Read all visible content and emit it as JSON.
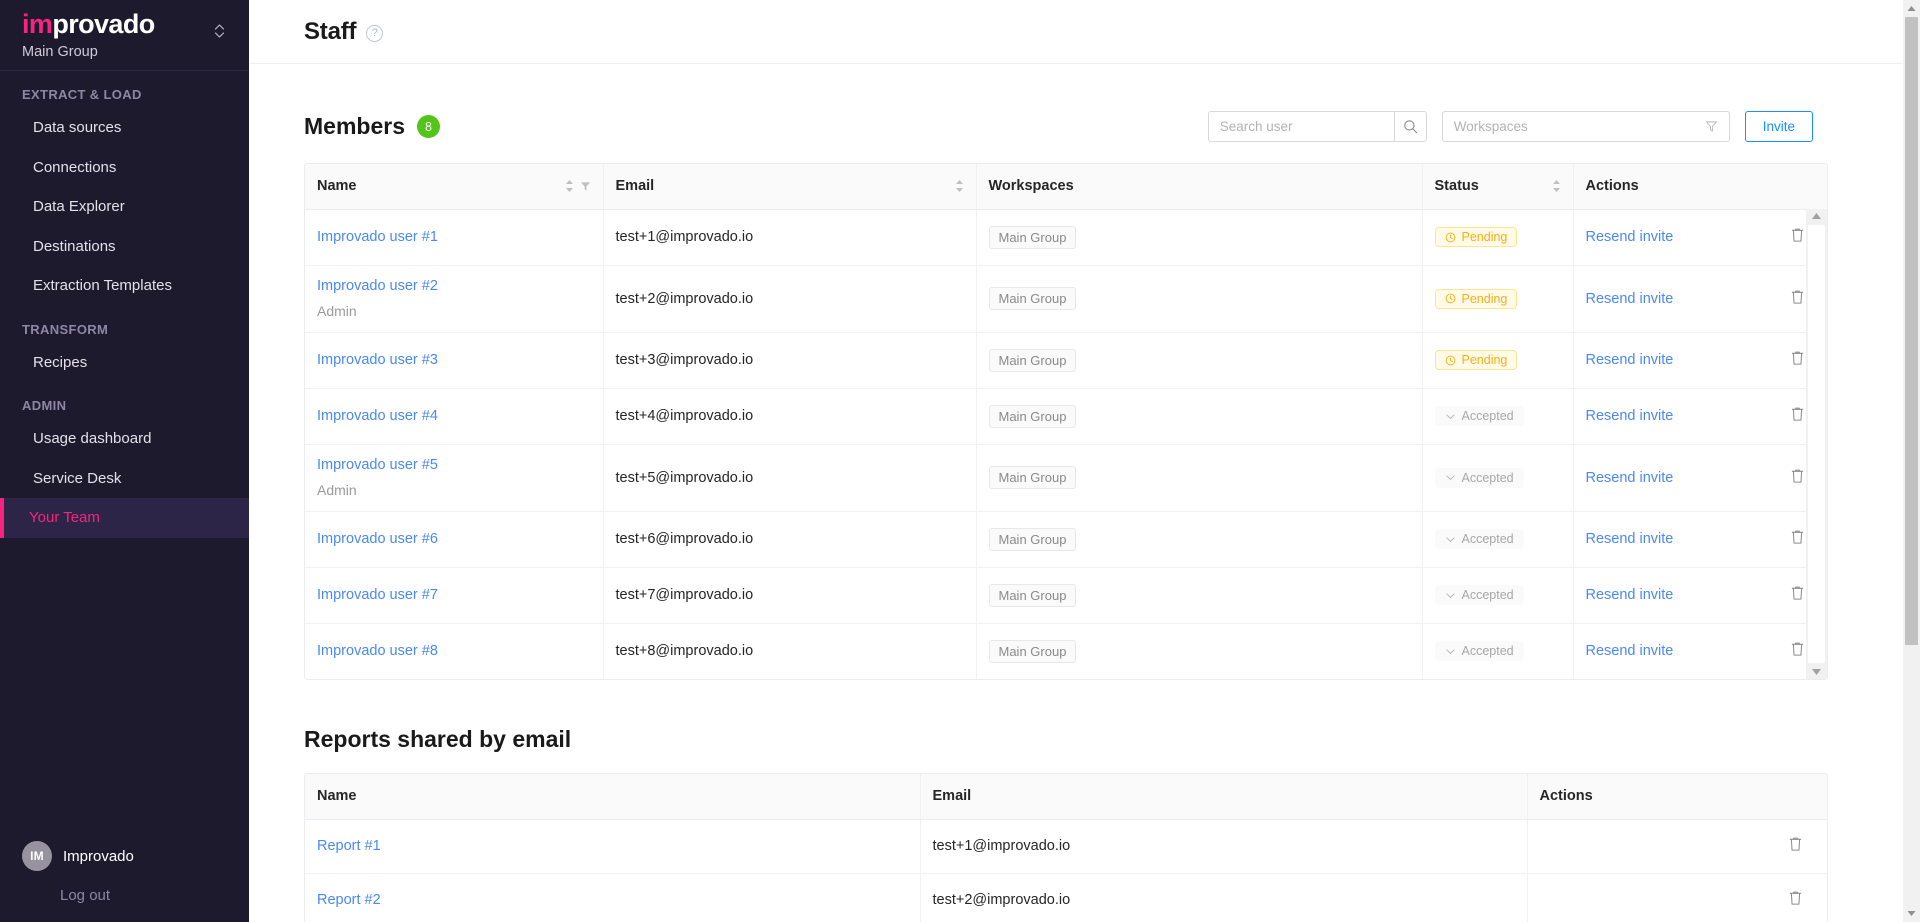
{
  "brand": {
    "logo_prefix": "im",
    "logo_suffix": "provado",
    "group_name": "Main Group"
  },
  "sidebar": {
    "sections": [
      {
        "label": "EXTRACT & LOAD",
        "items": [
          {
            "label": "Data sources",
            "active": false
          },
          {
            "label": "Connections",
            "active": false
          },
          {
            "label": "Data Explorer",
            "active": false
          },
          {
            "label": "Destinations",
            "active": false
          },
          {
            "label": "Extraction Templates",
            "active": false
          }
        ]
      },
      {
        "label": "TRANSFORM",
        "items": [
          {
            "label": "Recipes",
            "active": false
          }
        ]
      },
      {
        "label": "ADMIN",
        "items": [
          {
            "label": "Usage dashboard",
            "active": false
          },
          {
            "label": "Service Desk",
            "active": false
          },
          {
            "label": "Your Team",
            "active": true
          }
        ]
      }
    ],
    "footer": {
      "avatar_initials": "IM",
      "username": "Improvado",
      "logout_label": "Log out"
    }
  },
  "header": {
    "title": "Staff",
    "help_icon": "question-mark-icon"
  },
  "members": {
    "title": "Members",
    "count": "8",
    "search": {
      "placeholder": "Search user",
      "value": "",
      "icon": "search-icon"
    },
    "workspaces_filter": {
      "placeholder": "Workspaces",
      "value": "",
      "icon": "filter-funnel-icon"
    },
    "invite_label": "Invite",
    "columns": [
      {
        "label": "Name",
        "sortable": true,
        "filterable": true
      },
      {
        "label": "Email",
        "sortable": true,
        "filterable": false
      },
      {
        "label": "Workspaces",
        "sortable": false,
        "filterable": false
      },
      {
        "label": "Status",
        "sortable": true,
        "filterable": false
      },
      {
        "label": "Actions",
        "sortable": false,
        "filterable": false
      }
    ],
    "rows": [
      {
        "name": "Improvado user #1",
        "role": "",
        "email": "test+1@improvado.io",
        "workspace": "Main Group",
        "status": "Pending",
        "status_type": "pending",
        "action": "Resend invite"
      },
      {
        "name": "Improvado user #2",
        "role": "Admin",
        "email": "test+2@improvado.io",
        "workspace": "Main Group",
        "status": "Pending",
        "status_type": "pending",
        "action": "Resend invite"
      },
      {
        "name": "Improvado user #3",
        "role": "",
        "email": "test+3@improvado.io",
        "workspace": "Main Group",
        "status": "Pending",
        "status_type": "pending",
        "action": "Resend invite"
      },
      {
        "name": "Improvado user #4",
        "role": "",
        "email": "test+4@improvado.io",
        "workspace": "Main Group",
        "status": "Accepted",
        "status_type": "accepted",
        "action": "Resend invite"
      },
      {
        "name": "Improvado user #5",
        "role": "Admin",
        "email": "test+5@improvado.io",
        "workspace": "Main Group",
        "status": "Accepted",
        "status_type": "accepted",
        "action": "Resend invite"
      },
      {
        "name": "Improvado user #6",
        "role": "",
        "email": "test+6@improvado.io",
        "workspace": "Main Group",
        "status": "Accepted",
        "status_type": "accepted",
        "action": "Resend invite"
      },
      {
        "name": "Improvado user #7",
        "role": "",
        "email": "test+7@improvado.io",
        "workspace": "Main Group",
        "status": "Accepted",
        "status_type": "accepted",
        "action": "Resend invite"
      },
      {
        "name": "Improvado user #8",
        "role": "",
        "email": "test+8@improvado.io",
        "workspace": "Main Group",
        "status": "Accepted",
        "status_type": "accepted",
        "action": "Resend invite"
      }
    ]
  },
  "reports": {
    "title": "Reports shared by email",
    "columns": [
      {
        "label": "Name"
      },
      {
        "label": "Email"
      },
      {
        "label": "Actions"
      }
    ],
    "rows": [
      {
        "name": "Report #1",
        "email": "test+1@improvado.io"
      },
      {
        "name": "Report #2",
        "email": "test+2@improvado.io"
      }
    ]
  },
  "colors": {
    "accent_pink": "#f8237e",
    "sidebar_bg": "#1e1a2e",
    "link_blue": "#4a89f3",
    "invite_blue": "#1890ff",
    "badge_green": "#52c41a",
    "pending_amber": "#faad14"
  }
}
